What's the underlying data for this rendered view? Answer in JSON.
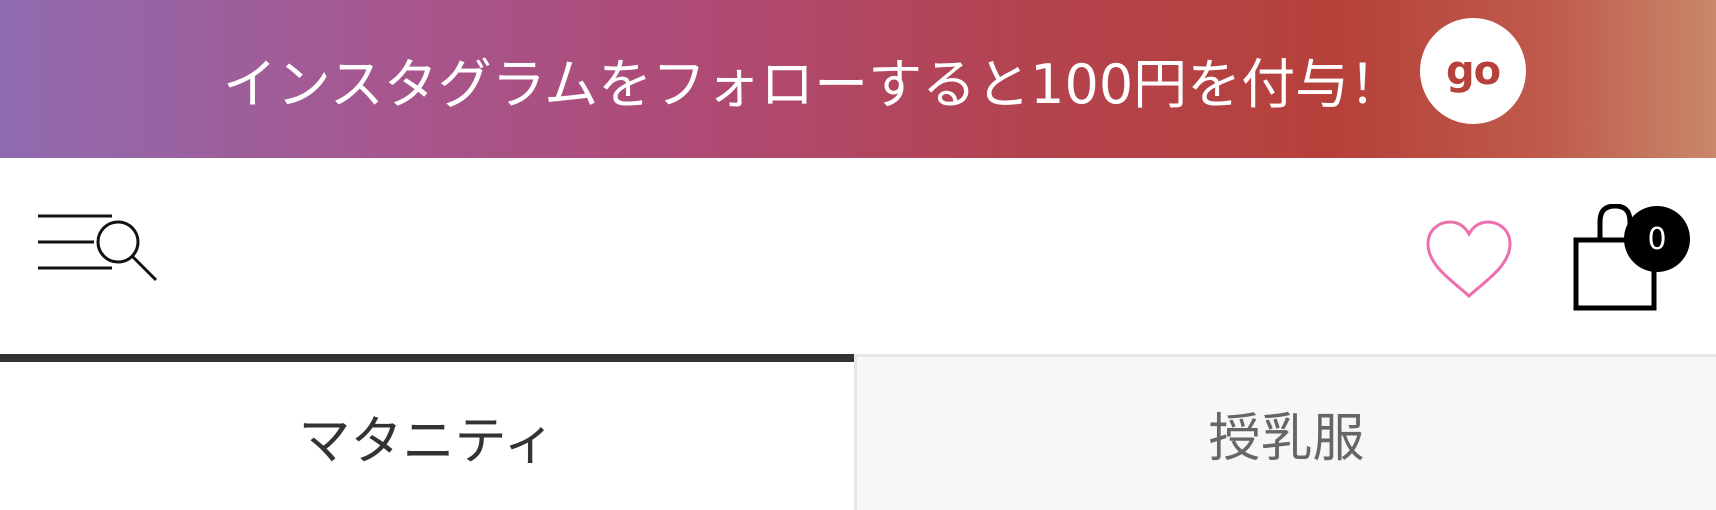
{
  "promo_banner": {
    "text": "インスタグラムをフォローすると100円を付与！",
    "go_label": "go"
  },
  "header": {
    "menu_search_icon": "menu-search-icon",
    "favorites_icon": "heart-icon",
    "cart_icon": "shopping-bag-icon",
    "cart_count": "0"
  },
  "tabs": [
    {
      "label": "マタニティ",
      "active": true
    },
    {
      "label": "授乳服",
      "active": false
    }
  ],
  "colors": {
    "banner_gradient_start": "#8f6bb0",
    "banner_gradient_end": "#c9876b",
    "heart": "#ee6fae",
    "badge": "#000000",
    "tab_active_border": "#333333",
    "tab_inactive_bg": "#f7f7f7"
  }
}
